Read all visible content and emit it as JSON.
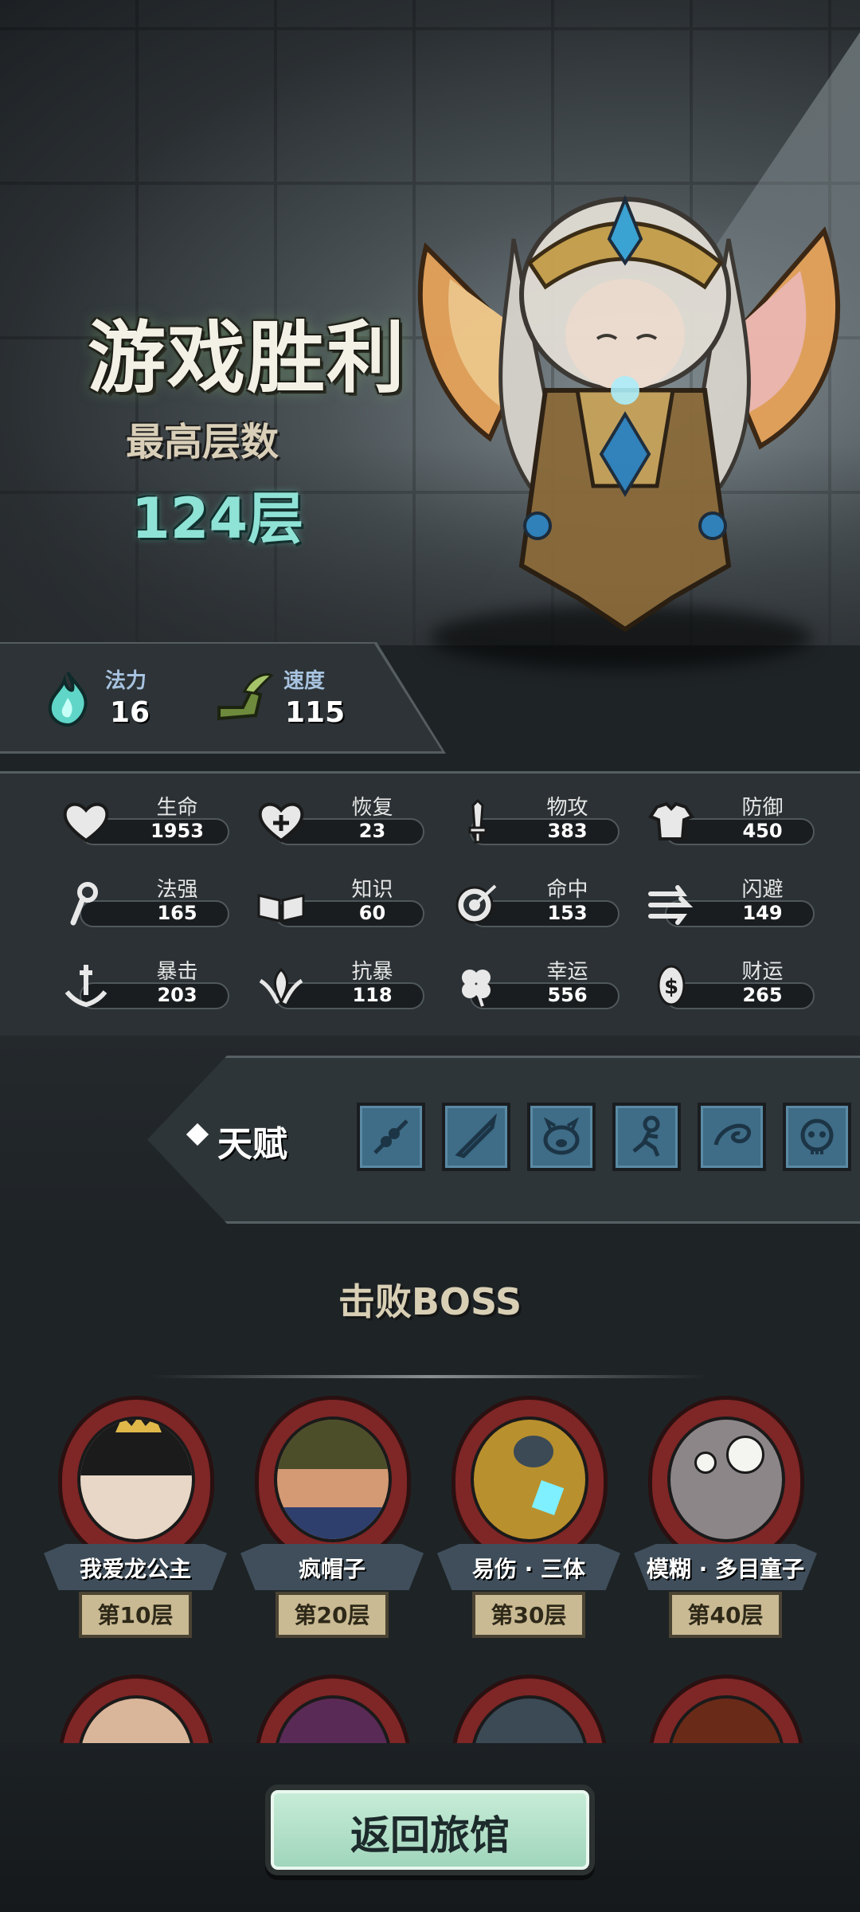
{
  "header": {
    "result_title": "游戏胜利",
    "highest_floor_label": "最高层数",
    "highest_floor_value": "124层"
  },
  "core_stats": [
    {
      "icon": "blue-flame-icon",
      "label": "法力",
      "value": "16"
    },
    {
      "icon": "winged-boot-icon",
      "label": "速度",
      "value": "115"
    }
  ],
  "attributes": [
    {
      "icon": "heart-icon",
      "label": "生命",
      "value": "1953"
    },
    {
      "icon": "heart-plus-icon",
      "label": "恢复",
      "value": "23"
    },
    {
      "icon": "sword-icon",
      "label": "物攻",
      "value": "383"
    },
    {
      "icon": "armor-icon",
      "label": "防御",
      "value": "450"
    },
    {
      "icon": "staff-icon",
      "label": "法强",
      "value": "165"
    },
    {
      "icon": "book-icon",
      "label": "知识",
      "value": "60"
    },
    {
      "icon": "target-icon",
      "label": "命中",
      "value": "153"
    },
    {
      "icon": "dodge-arrows-icon",
      "label": "闪避",
      "value": "149"
    },
    {
      "icon": "crit-blade-icon",
      "label": "暴击",
      "value": "203"
    },
    {
      "icon": "shield-wings-icon",
      "label": "抗暴",
      "value": "118"
    },
    {
      "icon": "clover-icon",
      "label": "幸运",
      "value": "556"
    },
    {
      "icon": "coin-icon",
      "label": "财运",
      "value": "265"
    }
  ],
  "talent": {
    "label": "天赋",
    "slots": [
      "skewer-icon",
      "blade-icon",
      "pig-icon",
      "running-figure-icon",
      "swirl-icon",
      "skull-icon"
    ]
  },
  "bosses": {
    "title": "击败BOSS",
    "defeated": [
      {
        "name": "我爱龙公主",
        "floor": "第10层"
      },
      {
        "name": "疯帽子",
        "floor": "第20层"
      },
      {
        "name": "易伤 · 三体",
        "floor": "第30层"
      },
      {
        "name": "模糊 · 多目童子",
        "floor": "第40层"
      }
    ]
  },
  "footer": {
    "return_button": "返回旅馆"
  },
  "colors": {
    "title": "#f3f0e6",
    "floor_value": "#8fe3d6",
    "boss_ring": "#7f2626",
    "button": "#b5e3cb"
  }
}
